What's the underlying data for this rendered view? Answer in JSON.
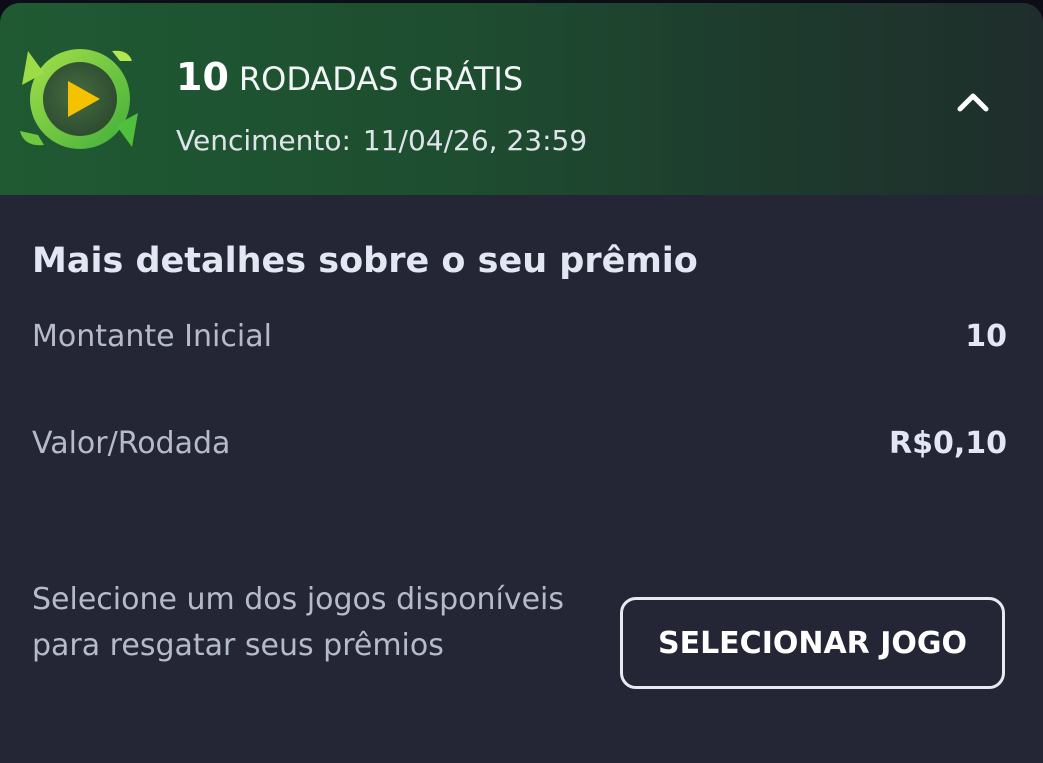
{
  "bonus": {
    "count": "10",
    "label": "RODADAS GRÁTIS",
    "expiry_label": "Vencimento:",
    "expiry_value": "11/04/26, 23:59",
    "icon": "free-spins-icon",
    "collapse_icon": "chevron-up-icon"
  },
  "details": {
    "title": "Mais detalhes sobre o seu prêmio",
    "rows": [
      {
        "label": "Montante Inicial",
        "value": "10"
      },
      {
        "label": "Valor/Rodada",
        "value": "R$0,10"
      }
    ]
  },
  "action": {
    "instruction": "Selecione um dos jogos disponíveis para resgatar seus prêmios",
    "button_label": "SELECIONAR JOGO"
  },
  "colors": {
    "card_background": "#242636",
    "header_green": "#1f5a32",
    "icon_green": "#7ed23e",
    "icon_play": "#f5c200"
  }
}
